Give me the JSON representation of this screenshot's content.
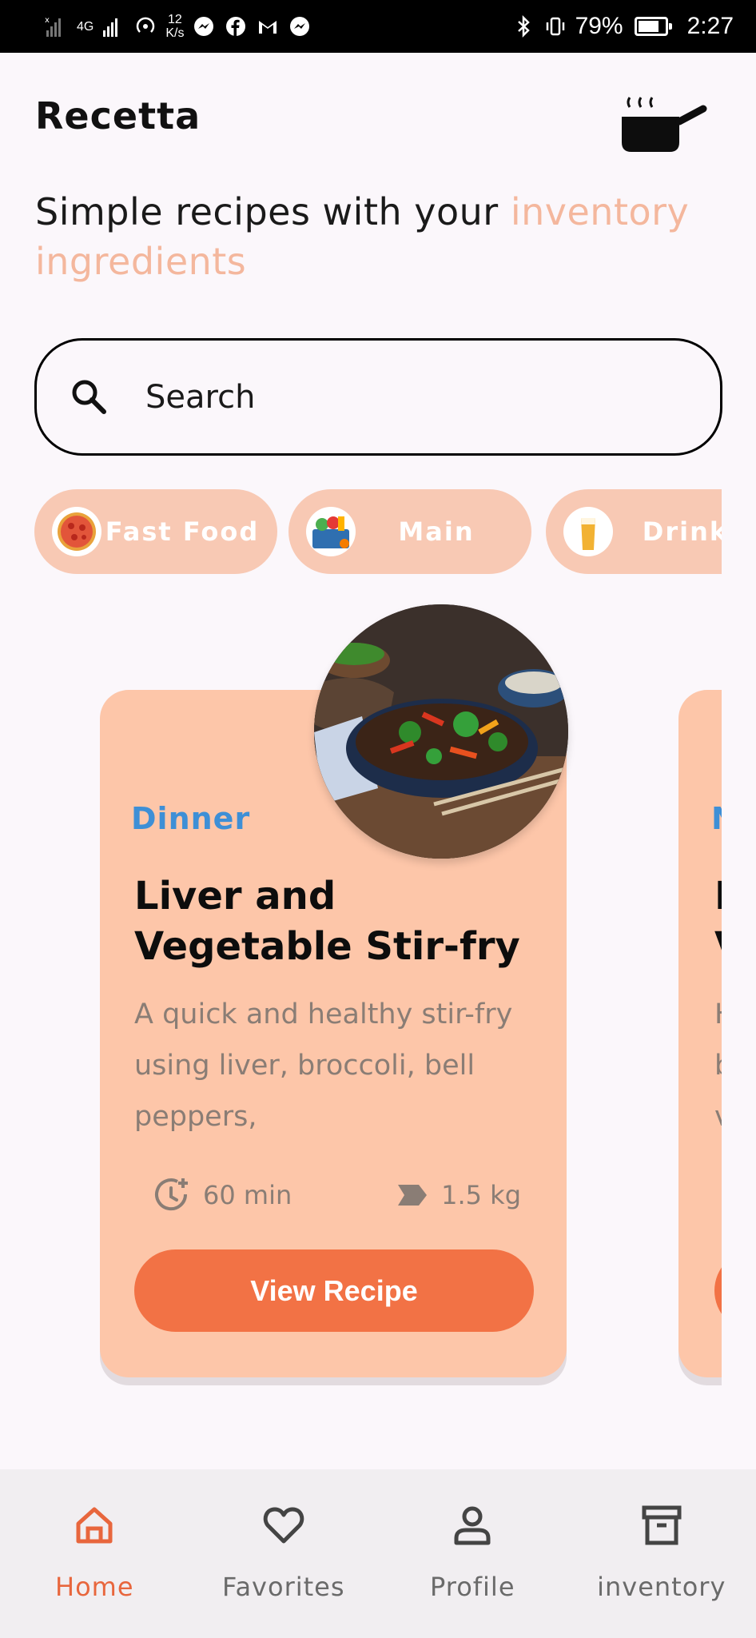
{
  "status_bar": {
    "signal": "4G",
    "speed_value": "12",
    "speed_unit": "K/s",
    "battery": "79%",
    "battery_level": 0.79,
    "time": "2:27",
    "icons": [
      "messenger-icon",
      "facebook-icon",
      "gmail-icon",
      "messenger-icon",
      "bluetooth-icon",
      "vibrate-icon"
    ]
  },
  "header": {
    "title": "Recetta",
    "icon": "cooking-pot-icon"
  },
  "tagline": {
    "text": "Simple recipes with your ",
    "accent": "inventory ingredients",
    "accent_color": "#f4b79d"
  },
  "search": {
    "placeholder": "Search",
    "icon": "search-icon"
  },
  "categories": [
    {
      "label": "Fast Food",
      "icon": "pizza-icon"
    },
    {
      "label": "Main",
      "icon": "groceries-icon"
    },
    {
      "label": "Drinks",
      "icon": "beer-icon"
    }
  ],
  "recipes": [
    {
      "category": "Dinner",
      "title": "Liver and Vegetable Stir-fry",
      "description": "A quick and healthy stir-fry using liver, broccoli, bell peppers,",
      "time": "60 min",
      "weight": "1.5 kg",
      "button_label": "View Recipe"
    }
  ],
  "next_card_peek": {
    "category": "N",
    "title_line1": "I",
    "title_line2": "V",
    "desc_line1": "H",
    "desc_line2": "b",
    "desc_line3": "v"
  },
  "colors": {
    "accent": "#f27245",
    "card": "#fdc6a9",
    "chip": "#f8c9b4",
    "category_blue": "#3e8fd6",
    "nav_active": "#e8663d"
  },
  "bottom_nav": [
    {
      "label": "Home",
      "icon": "home-icon",
      "active": true
    },
    {
      "label": "Favorites",
      "icon": "heart-icon",
      "active": false
    },
    {
      "label": "Profile",
      "icon": "profile-icon",
      "active": false
    },
    {
      "label": "inventory",
      "icon": "archive-box-icon",
      "active": false
    }
  ]
}
